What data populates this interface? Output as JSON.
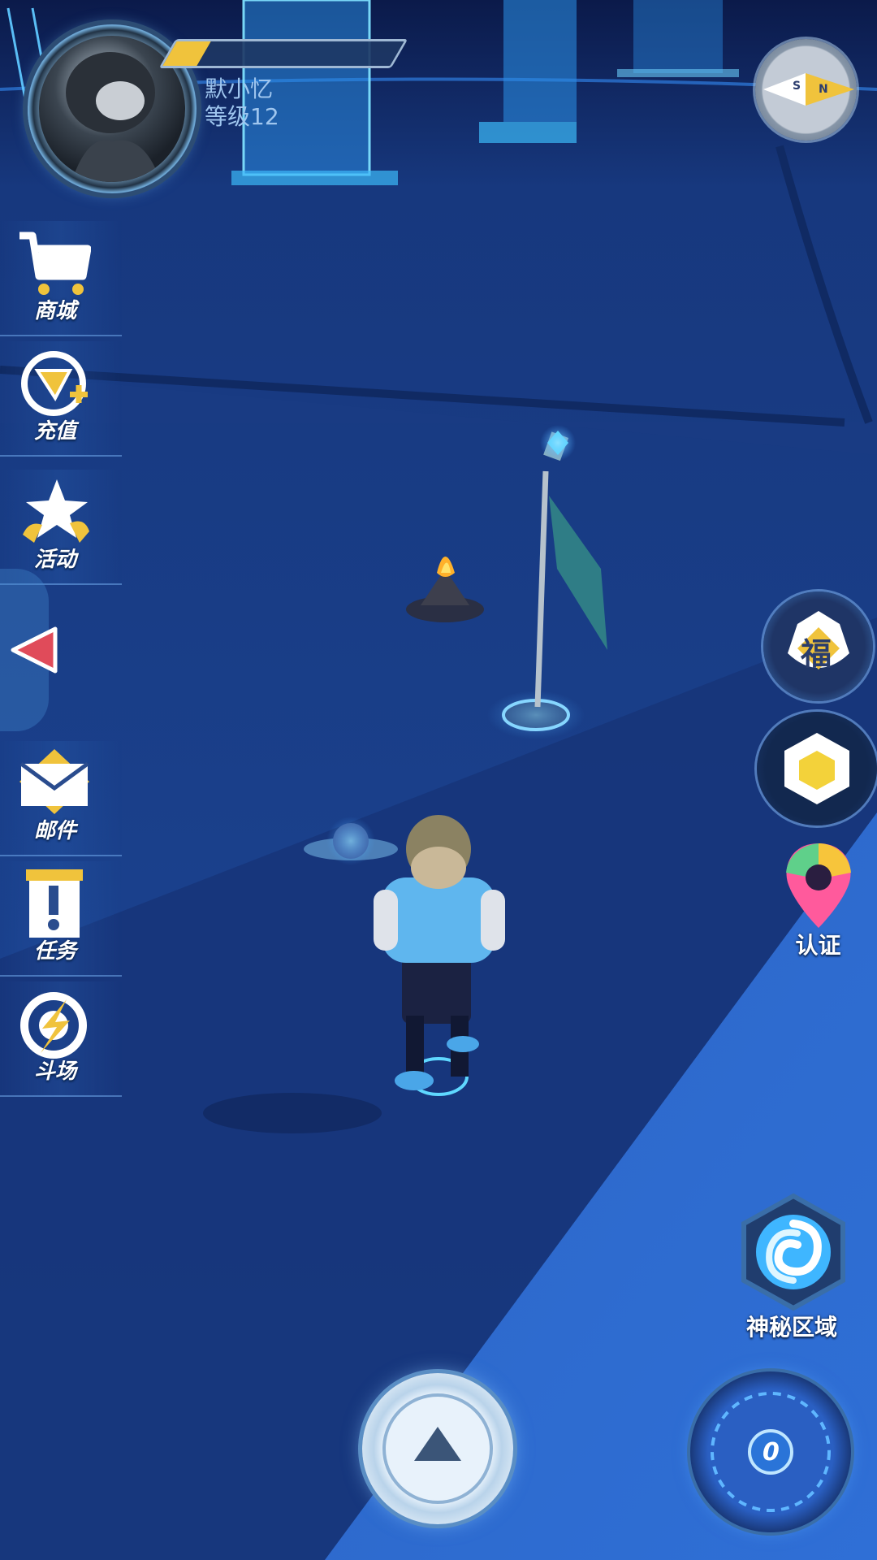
{
  "player": {
    "name": "默小忆",
    "level_text": "等级12",
    "xp_progress": 0.15
  },
  "compass": {
    "letters": [
      "S",
      "N"
    ]
  },
  "left_menu": {
    "items": [
      {
        "label": "商城",
        "icon": "shopping-cart-icon"
      },
      {
        "label": "充值",
        "icon": "recharge-icon"
      },
      {
        "label": "活动",
        "icon": "star-activity-icon"
      },
      {
        "label": "邮件",
        "icon": "mail-icon"
      },
      {
        "label": "任务",
        "icon": "task-icon"
      },
      {
        "label": "斗场",
        "icon": "arena-icon"
      }
    ],
    "collapse_icon": "collapse-arrow-icon"
  },
  "right_buttons": {
    "fortune": {
      "glyph": "福",
      "icon": "fortune-bag-icon"
    },
    "cube": {
      "icon": "cube-icon"
    },
    "verify": {
      "label": "认证",
      "icon": "map-pin-icon"
    },
    "mystery": {
      "label": "神秘区域",
      "icon": "swirl-portal-icon"
    },
    "radar": {
      "value": "0",
      "icon": "radar-icon"
    }
  },
  "controls": {
    "jump_icon": "up-triangle-icon"
  },
  "colors": {
    "accent_gold": "#f0c33c",
    "accent_blue": "#3fb6ff",
    "menu_text": "#ffffff"
  }
}
